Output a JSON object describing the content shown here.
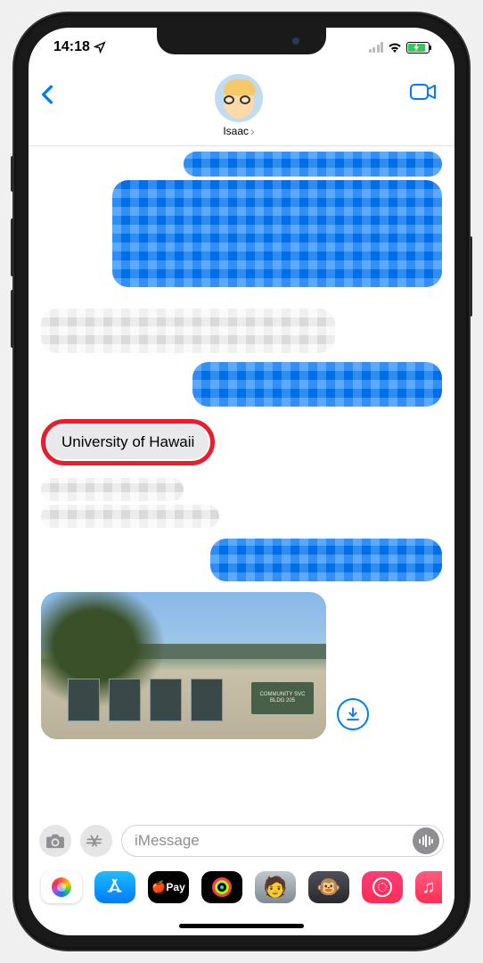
{
  "status": {
    "time": "14:18",
    "location_icon": "location-arrow"
  },
  "header": {
    "contact_name": "Isaac"
  },
  "messages": {
    "highlighted_text": "University of Hawaii",
    "image_sign_line1": "COMMUNITY SVC",
    "image_sign_line2": "BLDG 205"
  },
  "input": {
    "placeholder": "iMessage"
  },
  "apps": {
    "pay_label": "Pay"
  }
}
